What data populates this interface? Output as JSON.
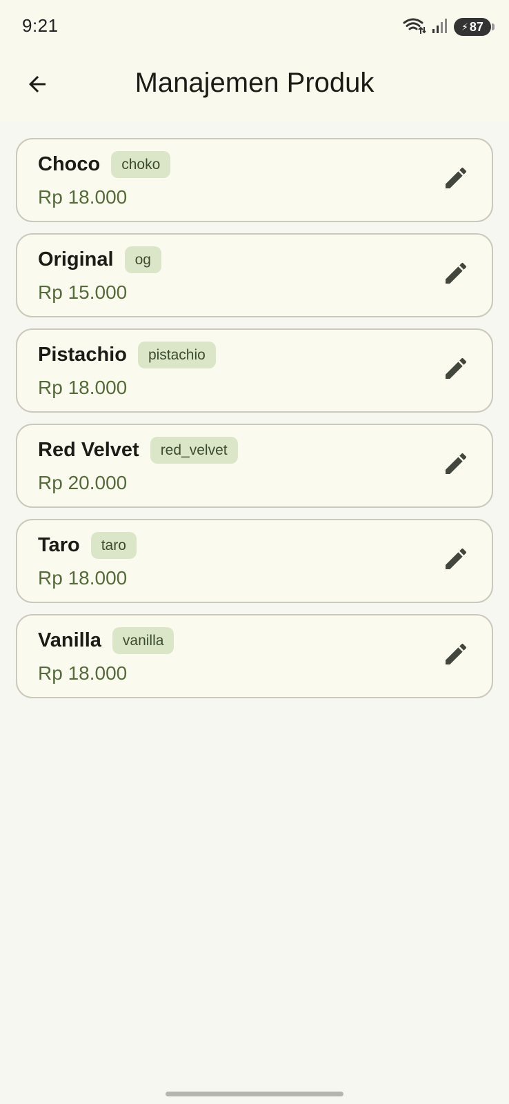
{
  "status_bar": {
    "time": "9:21",
    "battery": "87",
    "icons": [
      "wifi-icon",
      "signal-icon",
      "battery-icon"
    ]
  },
  "app_bar": {
    "title": "Manajemen Produk",
    "back_icon": "arrow-left-icon"
  },
  "products": [
    {
      "name": "Choco",
      "slug": "choko",
      "price": "Rp 18.000"
    },
    {
      "name": "Original",
      "slug": "og",
      "price": "Rp 15.000"
    },
    {
      "name": "Pistachio",
      "slug": "pistachio",
      "price": "Rp 18.000"
    },
    {
      "name": "Red Velvet",
      "slug": "red_velvet",
      "price": "Rp 20.000"
    },
    {
      "name": "Taro",
      "slug": "taro",
      "price": "Rp 18.000"
    },
    {
      "name": "Vanilla",
      "slug": "vanilla",
      "price": "Rp 18.000"
    }
  ],
  "colors": {
    "background": "#f7f7f1",
    "card": "#fafaee",
    "chip": "#dbe6c9",
    "price": "#556b3a",
    "icon": "#43463c"
  }
}
